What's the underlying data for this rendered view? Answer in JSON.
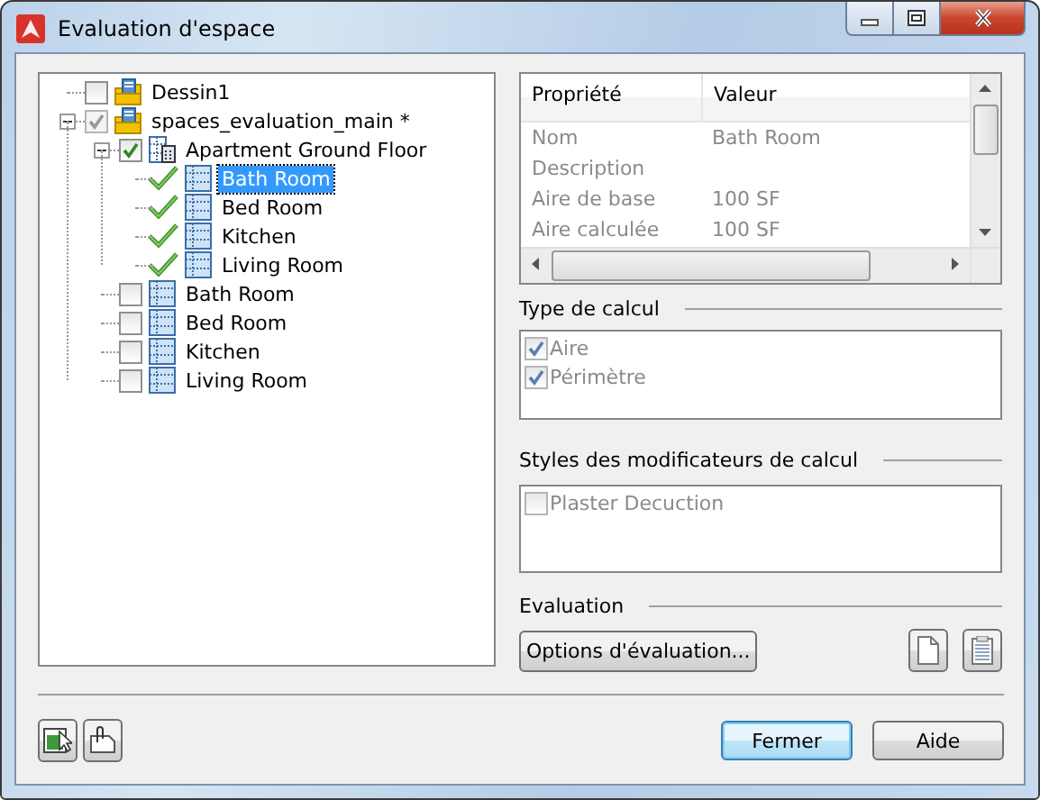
{
  "window": {
    "title": "Evaluation d'espace"
  },
  "tree": [
    {
      "label": "Dessin1",
      "kind": "drawing",
      "checked": false,
      "disabled": false,
      "evaluated": false,
      "selected": false
    },
    {
      "label": "spaces_evaluation_main *",
      "kind": "drawing",
      "checked": true,
      "disabled": true,
      "evaluated": false,
      "selected": false,
      "expanded": true,
      "children": [
        {
          "label": "Apartment Ground Floor",
          "kind": "zone",
          "checked": true,
          "disabled": false,
          "evaluated": false,
          "selected": false,
          "expanded": true,
          "children": [
            {
              "label": "Bath Room",
              "kind": "space",
              "checked": true,
              "disabled": false,
              "evaluated": true,
              "selected": true
            },
            {
              "label": "Bed Room",
              "kind": "space",
              "checked": true,
              "disabled": false,
              "evaluated": true,
              "selected": false
            },
            {
              "label": "Kitchen",
              "kind": "space",
              "checked": true,
              "disabled": false,
              "evaluated": true,
              "selected": false
            },
            {
              "label": "Living Room",
              "kind": "space",
              "checked": true,
              "disabled": false,
              "evaluated": true,
              "selected": false
            }
          ]
        },
        {
          "label": "Bath Room",
          "kind": "space",
          "checked": false,
          "disabled": false,
          "evaluated": false,
          "selected": false
        },
        {
          "label": "Bed Room",
          "kind": "space",
          "checked": false,
          "disabled": false,
          "evaluated": false,
          "selected": false
        },
        {
          "label": "Kitchen",
          "kind": "space",
          "checked": false,
          "disabled": false,
          "evaluated": false,
          "selected": false
        },
        {
          "label": "Living Room",
          "kind": "space",
          "checked": false,
          "disabled": false,
          "evaluated": false,
          "selected": false
        }
      ]
    }
  ],
  "properties": {
    "columns": [
      "Propriété",
      "Valeur"
    ],
    "rows": [
      [
        "Nom",
        "Bath Room"
      ],
      [
        "Description",
        ""
      ],
      [
        "Aire de base",
        "100  SF"
      ],
      [
        "Aire calculée",
        "100  SF"
      ]
    ]
  },
  "calc_type": {
    "title": "Type de calcul",
    "items": [
      {
        "label": "Aire",
        "checked": true,
        "disabled": true
      },
      {
        "label": "Périmètre",
        "checked": true,
        "disabled": true
      }
    ]
  },
  "modifiers": {
    "title": "Styles des modificateurs de calcul",
    "items": [
      {
        "label": "Plaster Decuction",
        "checked": false,
        "disabled": true
      }
    ]
  },
  "evaluation": {
    "title": "Evaluation",
    "button": "Options d'évaluation..."
  },
  "buttons": [
    "Fermer",
    "Aide"
  ]
}
